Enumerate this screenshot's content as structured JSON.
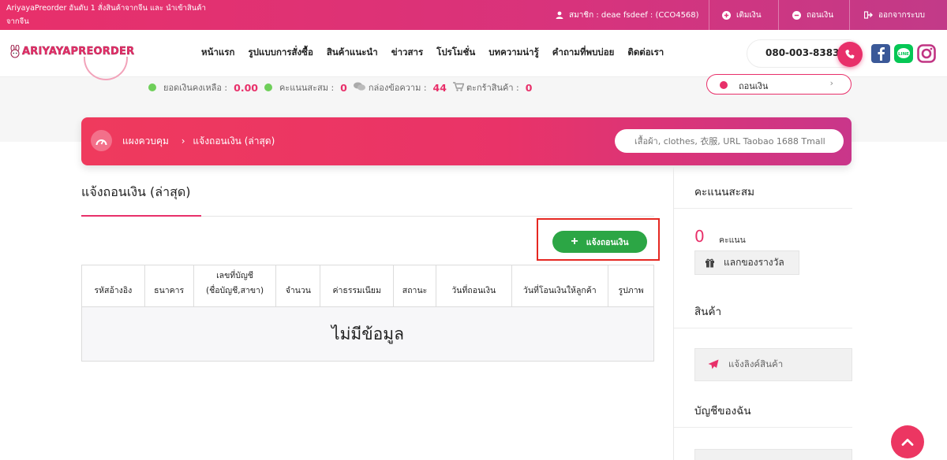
{
  "topbar": {
    "tagline": "AriyayaPreorder อันดับ 1 สั่งสินค้าจากจีน และ นำเข้าสินค้าจากจีน",
    "member": "สมาชิก : deae fsdeef : (CCO4568)",
    "topup": "เติมเงิน",
    "withdraw": "ถอนเงิน",
    "logout": "ออกจากระบบ"
  },
  "nav": {
    "logo": "ARIYAYAPREORDER",
    "links": [
      "หน้าแรก",
      "รูปแบบการสั่งซื้อ",
      "สินค้าแนะนำ",
      "ข่าวสาร",
      "โปรโมชั่น",
      "บทความน่ารู้",
      "คำถามที่พบบ่อย",
      "ติดต่อเรา"
    ],
    "phone": "080-003-8383"
  },
  "profile": {
    "balance_label": "ยอดเงินคงเหลือ :",
    "balance_value": "0.00",
    "points_label": "คะแนนสะสม :",
    "points_value": "0",
    "inbox_label": "กล่องข้อความ :",
    "inbox_value": "44",
    "cart_label": "ตะกร้าสินค้า :",
    "cart_value": "0",
    "withdraw_button": "ถอนเงิน"
  },
  "banner": {
    "dashboard": "แผงควบคุม",
    "current": "แจ้งถอนเงิน (ล่าสุด)",
    "search_placeholder": "เสื้อผ้า, clothes, 衣服, URL Taobao 1688 Tmall"
  },
  "main": {
    "title": "แจ้งถอนเงิน (ล่าสุด)",
    "add_button": "แจ้งถอนเงิน",
    "table": {
      "headers": [
        "รหัสอ้างอิง",
        "ธนาคาร",
        "เลขที่บัญชี\n(ชื่อบัญชี,สาขา)",
        "จำนวน",
        "ค่าธรรมเนียม",
        "สถานะ",
        "วันที่ถอนเงิน",
        "วันที่โอนเงินให้ลูกค้า",
        "รูปภาพ"
      ],
      "empty_text": "ไม่มีข้อมูล"
    }
  },
  "sidebar": {
    "points_heading": "คะแนนสะสม",
    "points_value": "0",
    "points_unit": "คะแนน",
    "redeem_button": "แลกของรางวัล",
    "products_heading": "สินค้า",
    "notify_link": "แจ้งลิงค์สินค้า",
    "account_heading": "บัญชีของฉัน"
  },
  "colors": {
    "brand_pink": "#e8306a",
    "success_green": "#2ca645",
    "highlight_red": "#e52822"
  },
  "icons": [
    "user-icon",
    "plus-circle-icon",
    "minus-circle-icon",
    "logout-icon",
    "phone-icon",
    "facebook-icon",
    "line-icon",
    "instagram-icon",
    "dashboard-icon",
    "chat-icon",
    "cart-icon",
    "gift-icon",
    "paper-plane-icon",
    "chevron-up-icon"
  ]
}
